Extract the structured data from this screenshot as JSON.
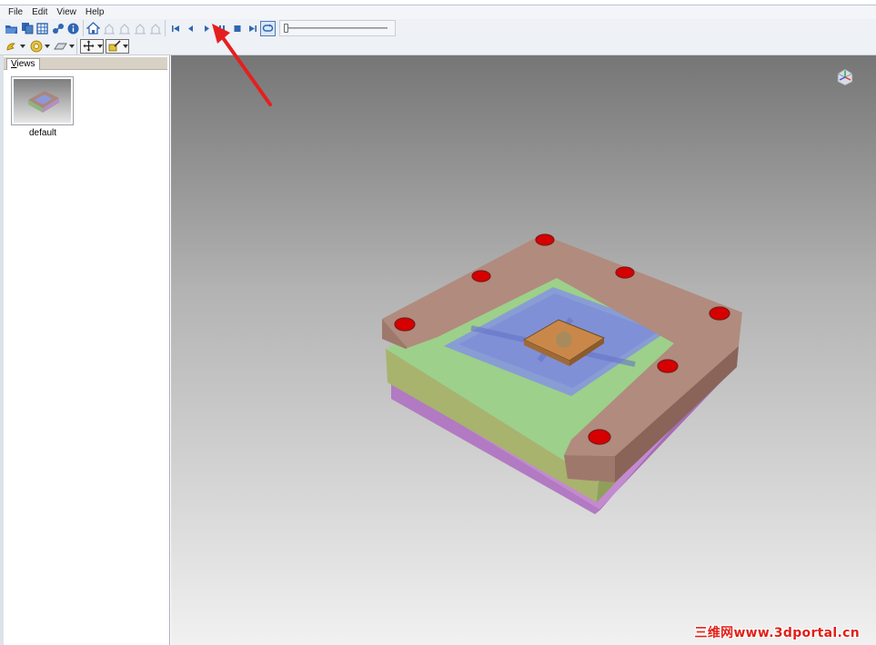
{
  "menu": {
    "items": [
      "File",
      "Edit",
      "View",
      "Help"
    ]
  },
  "toolbar": {
    "file_tools": [
      "open-folder-icon",
      "save-files-icon",
      "table-icon",
      "share-icon",
      "info-icon"
    ],
    "view_tools": [
      "home-view-icon",
      "camera-front-icon",
      "camera-top-icon",
      "camera-side-icon",
      "camera-iso-icon"
    ],
    "playback_tools": [
      "skip-to-start-icon",
      "step-back-icon",
      "play-icon",
      "pause-icon",
      "stop-icon",
      "skip-to-end-icon",
      "loop-icon"
    ],
    "animation_position": 0.0
  },
  "toolbar2": {
    "tools": [
      "light-icon",
      "target-icon",
      "plane-icon",
      "pan-icon",
      "paint-icon"
    ]
  },
  "views_panel": {
    "tab_label_first": "V",
    "tab_label_rest": "iews",
    "items": [
      {
        "label": "default"
      }
    ]
  },
  "watermark": {
    "text": "三维网www.3dportal.cn"
  },
  "colors": {
    "accent": "#2f66b3",
    "annotation_arrow": "#e51f1f",
    "mold_top_plate": "#b08a7c",
    "mold_middle_plate": "#8fc47a",
    "mold_bottom_plate": "#c58ad3",
    "cavity": "#7f8fe0",
    "screw_holes": "#d00000"
  }
}
